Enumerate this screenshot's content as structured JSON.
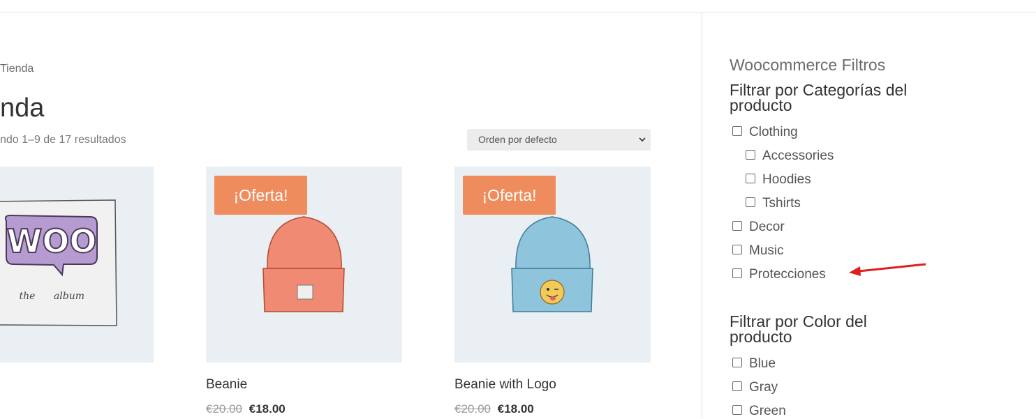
{
  "breadcrumb": "Tienda",
  "page_title": "nda",
  "result_count": "ndo 1–9 de 17 resultados",
  "sort": {
    "selected": "Orden por defecto"
  },
  "products": [
    {
      "name": "",
      "sale_badge": "",
      "old_price": "",
      "new_price": ""
    },
    {
      "name": "Beanie",
      "sale_badge": "¡Oferta!",
      "old_price": "€20.00",
      "new_price": "€18.00"
    },
    {
      "name": "Beanie with Logo",
      "sale_badge": "¡Oferta!",
      "old_price": "€20.00",
      "new_price": "€18.00"
    }
  ],
  "album_art": {
    "logo_text": "WOO",
    "caption_left": "the",
    "caption_right": "album"
  },
  "sidebar": {
    "widget_title": "Woocommerce Filtros",
    "category_filter": {
      "heading": "Filtrar por Categorías del producto",
      "items": [
        "Clothing",
        "Accessories",
        "Hoodies",
        "Tshirts",
        "Decor",
        "Music",
        "Protecciones"
      ]
    },
    "color_filter": {
      "heading": "Filtrar por Color del producto",
      "items": [
        "Blue",
        "Gray",
        "Green"
      ]
    }
  },
  "colors": {
    "sale_badge": "#ee8c5d",
    "image_bg": "#e9eff3",
    "annotation_arrow": "#e01e1e",
    "beanie_orange": "#f08a73",
    "beanie_blue": "#8fc4dd"
  }
}
